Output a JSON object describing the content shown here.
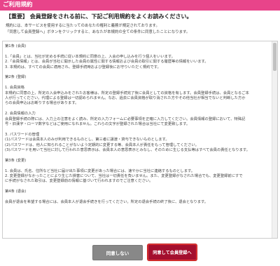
{
  "header": {
    "title": "ご利用規約"
  },
  "notice": "【重要】 会員登録をされる前に、下記ご利用規約をよくお読みください。",
  "intro": [
    "規約には、本サービスを使用するに当たってのあなたの権利と義務が規定されております。",
    "「同意して会員登録へ」ボタンをクリックすると、あなたが本規約の全ての条件に同意したことになります。"
  ],
  "terms": [
    "第1条 (会員)",
    "",
    "1.「会員」とは、当社が定める手続に従い本規約に同意の上、入会の申し込みを行う個人をいいます。",
    "2.「会員情報」とは、会員が当社に開示した会員の属性に関する情報および会員の取引に関する履歴等の情報をいいます。",
    "3. 本規約は、すべての会員に適用され、登録手続時および登録後にお守りいただく規約です。",
    "",
    "第2条 (登録)",
    "",
    "1. 会員資格",
    "本規約に同意の上、所定の入会申込みをされたお客様は、所定の登録手続完了後に会員としての資格を有します。会員登録手続は、会員となるご本",
    "人が行ってください。代理による登録は一切認められません。なお、過去に会員資格が取り消された方やその他当社が相当でないと判断した方か",
    "らの会員申込はお断りする場合があります。",
    "",
    "2. 会員情報の入力",
    "会員登録手続の際には、入力上の注意をよく読み、所定の入力フォームに必要事項を正確に入力してください。会員情報の登録において、特殊記",
    "号・旧漢字・ローマ数字などはご使用になれません。これらの文字が登録された場合は当社にて変更致します。",
    "",
    "3. パスワードの管理",
    "(1)パスワードは会員本人のみが利用できるものとし、第三者に譲渡・貸与できないものとします。",
    "(2)パスワードは、他人に知られることがないよう定期的に変更する等、会員本人が責任をもって管理してください。",
    "(3)パスワードを用いて当社に対して行われた意思表示は、会員本人の意思表示とみなし、そのために生じる支払等はすべて会員の責任となります。",
    "",
    "第3条 (変更)",
    "",
    "1. 会員は、氏名、住所など当社に届け出た事項に変更があった場合には、速やかに当社に連絡するものとします。",
    "2. 変更登録がなかったことにより生じた損害について、当社は一切責任を負いません。また、変更登録がなされた場合でも、変更登録前にすで",
    "に手続がなされた取引は、変更登録前の情報に基づいて行われますのでご注意ください。",
    "",
    "第4条 (退会)",
    "",
    "会員が退会を希望する場合には、会員本人が退会手続きを行ってください。所定の退会手続の終了後に、退会となります。"
  ],
  "buttons": {
    "decline": "同意しない",
    "agree": "同意して会員登録へ"
  }
}
